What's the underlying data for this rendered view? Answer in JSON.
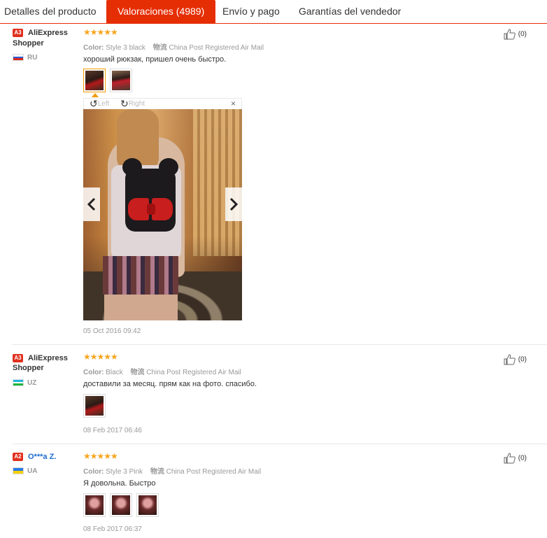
{
  "tabs": [
    {
      "label": "Detalles del producto"
    },
    {
      "label": "Valoraciones (4989)"
    },
    {
      "label": "Envío y pago"
    },
    {
      "label": "Garantías del vendedor"
    }
  ],
  "colors": {
    "accent": "#e62e04",
    "star": "#f7a51e",
    "badge": "#e0301e",
    "link": "#1c6bd0"
  },
  "icons": {
    "star": "★",
    "like": "thumbs-up-icon",
    "rotate_left": "rotate-left-icon",
    "rotate_right": "rotate-right-icon",
    "close": "close-icon",
    "prev": "chevron-left-icon",
    "next": "chevron-right-icon"
  },
  "reviews": [
    {
      "badge": "A3",
      "name_line1": "AliExpress",
      "name_line2": "Shopper",
      "country": "RU",
      "stars": "★★★★★",
      "rating": 5,
      "color_label": "Color:",
      "color_value": "Style 3 black",
      "ship_label": "物流",
      "ship_value": "China Post Registered Air Mail",
      "text": "хороший рюкзак, пришел очень быстро.",
      "date": "05 Oct 2016 09:42",
      "likes": "(0)",
      "viewer": {
        "left": "Left",
        "right": "Right",
        "close": "×"
      }
    },
    {
      "badge": "A3",
      "name_line1": "AliExpress",
      "name_line2": "Shopper",
      "country": "UZ",
      "stars": "★★★★★",
      "rating": 5,
      "color_label": "Color:",
      "color_value": "Black",
      "ship_label": "物流",
      "ship_value": "China Post Registered Air Mail",
      "text": "доставили за месяц. прям как на фото. спасибо.",
      "date": "08 Feb 2017 06:46",
      "likes": "(0)"
    },
    {
      "badge": "A2",
      "name_line1": "O***a Z.",
      "country": "UA",
      "stars": "★★★★★",
      "rating": 5,
      "color_label": "Color:",
      "color_value": "Style 3 Pink",
      "ship_label": "物流",
      "ship_value": "China Post Registered Air Mail",
      "text": "Я довольна. Быстро",
      "date": "08 Feb 2017 06:37",
      "likes": "(0)"
    }
  ]
}
